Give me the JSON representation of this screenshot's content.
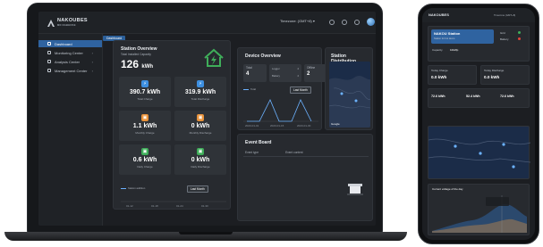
{
  "header": {
    "brand_name": "NAKOUBES",
    "brand_sub": "MN NABHOSE",
    "timezone": "Timezone: (GMT+8)",
    "timezone_caret": "▾"
  },
  "tabs": [
    "Dashboard"
  ],
  "sidebar": {
    "items": [
      {
        "label": "Dashboard",
        "active": true
      },
      {
        "label": "Monitoring Center",
        "chevron": "›"
      },
      {
        "label": "Analysis Center",
        "chevron": "›"
      },
      {
        "label": "Management Center",
        "chevron": "›"
      }
    ],
    "collapse_glyph": "⊞"
  },
  "station_overview": {
    "title": "Station Overview",
    "capacity_label": "Total Installed Capacity",
    "capacity_value": "126",
    "capacity_unit": "kWh",
    "stats": [
      {
        "value": "390.7 kWh",
        "label": "Total Charge",
        "color": "#3d8fe0",
        "icon": "⚡"
      },
      {
        "value": "319.9 kWh",
        "label": "Total Discharge",
        "color": "#3d8fe0",
        "icon": "⚡"
      },
      {
        "value": "1.1 kWh",
        "label": "Monthly Charge",
        "color": "#e8923a",
        "icon": "▣"
      },
      {
        "value": "0 kWh",
        "label": "Monthly Discharge",
        "color": "#e8923a",
        "icon": "▣"
      },
      {
        "value": "0.6 kWh",
        "label": "Daily Charge",
        "color": "#3fae5a",
        "icon": "▣"
      },
      {
        "value": "0 kWh",
        "label": "Daily Discharge",
        "color": "#3fae5a",
        "icon": "▣"
      }
    ],
    "legend_label": "Station addition",
    "toggle": [
      "Last Month"
    ],
    "axis_ticks": [
      "01-12",
      "01-18",
      "01-24",
      "01-30"
    ]
  },
  "device_overview": {
    "title": "Device Overview",
    "cells": [
      {
        "label": "Total",
        "value": "4"
      },
      {
        "label": "Logger",
        "sub_value": "2",
        "sub2_label": "Battery",
        "sub2_value": "2"
      },
      {
        "label": "Offline",
        "value": "2"
      }
    ],
    "legend_label": "Total",
    "toggle": [
      "Last Month"
    ],
    "axis_ticks": [
      "2023-01-01",
      "2023-01-15",
      "2023-01-30"
    ]
  },
  "station_distribution": {
    "title": "Station Distribution",
    "map_brand": "Google"
  },
  "event_board": {
    "title": "Event Board",
    "columns": [
      "Event type",
      "Event content"
    ]
  },
  "phone": {
    "brand_name": "NAKOUBES",
    "timezone": "Timezone (GMT+8)",
    "station_name": "NAKOU Station",
    "station_sub": "Station for bot demo",
    "capacity_label": "Capacity",
    "capacity_value": "10kWp",
    "status_labels": [
      "Grid",
      "Battery"
    ],
    "status_colors": [
      "#3fae5a",
      "#e0453a"
    ],
    "tiles": [
      {
        "label": "Today Charge",
        "value": "0.0 kWh"
      },
      {
        "label": "Today Discharge",
        "value": "0.0 kWh"
      }
    ],
    "energy_cells": [
      {
        "value": "72.6 kWh"
      },
      {
        "value": "52.4 kWh"
      },
      {
        "value": "72.6 kWh"
      }
    ],
    "chart_title": "Current voltage of the day"
  },
  "colors": {
    "accent": "#2f63a0",
    "panel": "#272a2f",
    "bg": "#1c1e22"
  }
}
